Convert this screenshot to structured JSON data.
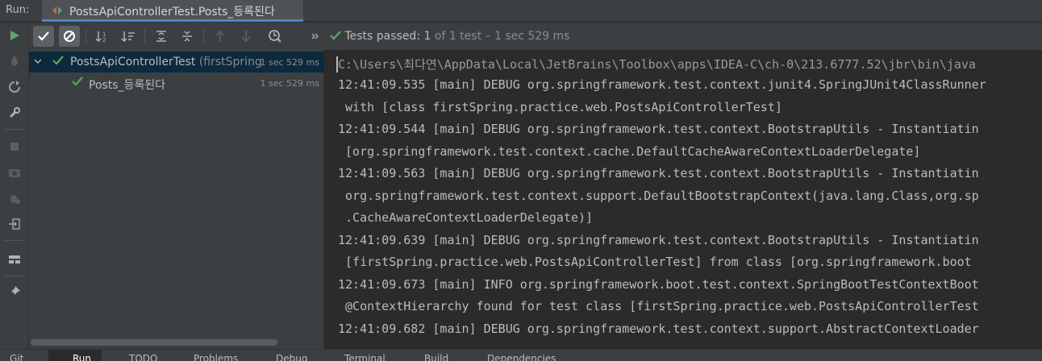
{
  "run_panel": {
    "label": "Run:",
    "tab_title": "PostsApiControllerTest.Posts_등록된다"
  },
  "colors": {
    "pass_green": "#59a869",
    "accent_blue": "#4a88c7",
    "selection": "#0d293e"
  },
  "icons": {
    "left_toolbar": [
      "run-icon",
      "debug-icon",
      "rerun-failed-icon",
      "wrench-icon",
      "stop-icon",
      "camera-icon",
      "bug-settings-icon",
      "exit-icon",
      "layout-icon",
      "pin-icon"
    ],
    "test_toolbar": [
      "show-passed-icon",
      "show-ignored-icon",
      "sort-alpha-icon",
      "sort-duration-icon",
      "expand-all-icon",
      "collapse-all-icon",
      "previous-failed-icon",
      "next-failed-icon",
      "history-icon",
      "more-icon"
    ]
  },
  "status": {
    "label": "Tests passed:",
    "passed": "1",
    "rest": "of 1 test – 1 sec 529 ms"
  },
  "tree": {
    "root": {
      "name": "PostsApiControllerTest",
      "package": "(firstSpring",
      "time": "1 sec 529 ms"
    },
    "child": {
      "name": "Posts_등록된다",
      "time": "1 sec 529 ms"
    }
  },
  "console": {
    "lines": [
      "C:\\Users\\최다연\\AppData\\Local\\JetBrains\\Toolbox\\apps\\IDEA-C\\ch-0\\213.6777.52\\jbr\\bin\\java",
      "12:41:09.535 [main] DEBUG org.springframework.test.context.junit4.SpringJUnit4ClassRunner",
      " with [class firstSpring.practice.web.PostsApiControllerTest]",
      "12:41:09.544 [main] DEBUG org.springframework.test.context.BootstrapUtils - Instantiatin",
      " [org.springframework.test.context.cache.DefaultCacheAwareContextLoaderDelegate]",
      "12:41:09.563 [main] DEBUG org.springframework.test.context.BootstrapUtils - Instantiatin",
      " org.springframework.test.context.support.DefaultBootstrapContext(java.lang.Class,org.sp",
      " .CacheAwareContextLoaderDelegate)]",
      "12:41:09.639 [main] DEBUG org.springframework.test.context.BootstrapUtils - Instantiatin",
      " [firstSpring.practice.web.PostsApiControllerTest] from class [org.springframework.boot",
      "12:41:09.673 [main] INFO org.springframework.boot.test.context.SpringBootTestContextBoot",
      " @ContextHierarchy found for test class [firstSpring.practice.web.PostsApiControllerTest",
      "12:41:09.682 [main] DEBUG org.springframework.test.context.support.AbstractContextLoader"
    ]
  },
  "bottom_tabs": [
    "Git",
    "Run",
    "TODO",
    "Problems",
    "Debug",
    "Terminal",
    "Build",
    "Dependencies"
  ]
}
